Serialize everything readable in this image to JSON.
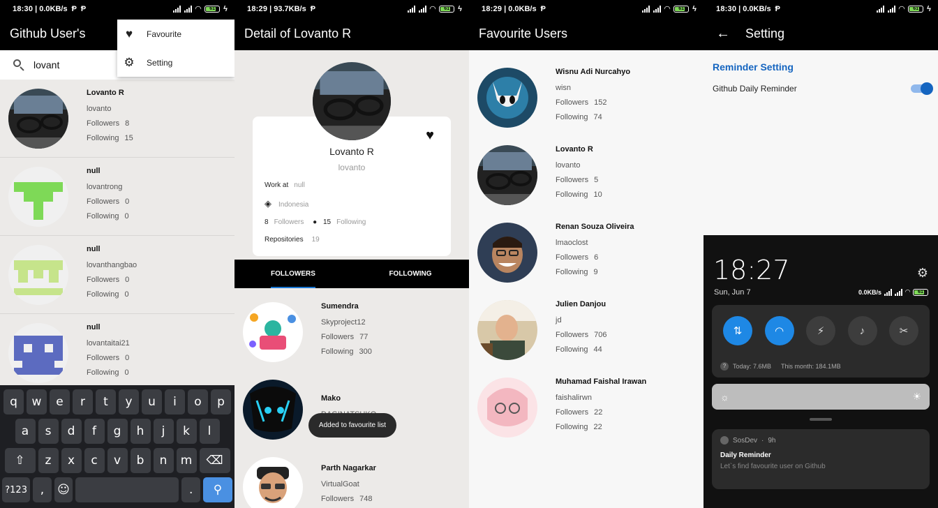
{
  "status": {
    "s1": {
      "time": "18:30",
      "speed": "0.0KB/s",
      "battery": "61"
    },
    "s2": {
      "time": "18:29",
      "speed": "93.7KB/s",
      "battery": "61"
    },
    "s3": {
      "time": "18:29",
      "speed": "0.0KB/s",
      "battery": "61"
    },
    "s4": {
      "time": "18:30",
      "speed": "0.0KB/s",
      "battery": "61"
    }
  },
  "search_screen": {
    "title": "Github User's",
    "search_value": "lovant",
    "menu": [
      {
        "label": "Favourite",
        "icon": "heart-icon"
      },
      {
        "label": "Setting",
        "icon": "gear-icon"
      }
    ],
    "users": [
      {
        "name": "Lovanto R",
        "login": "lovanto",
        "followers": "8",
        "following": "15",
        "avatar": "photo-glasses"
      },
      {
        "name": "null",
        "login": "lovantrong",
        "followers": "0",
        "following": "0",
        "avatar": "identicon-green"
      },
      {
        "name": "null",
        "login": "lovanthangbao",
        "followers": "0",
        "following": "0",
        "avatar": "identicon-lime"
      },
      {
        "name": "null",
        "login": "lovantaitai21",
        "followers": "0",
        "following": "0",
        "avatar": "identicon-purple"
      }
    ],
    "labels": {
      "followers": "Followers",
      "following": "Following"
    },
    "keyboard": {
      "row1": [
        "q",
        "w",
        "e",
        "r",
        "t",
        "y",
        "u",
        "i",
        "o",
        "p"
      ],
      "row2": [
        "a",
        "s",
        "d",
        "f",
        "g",
        "h",
        "j",
        "k",
        "l"
      ],
      "row3": [
        "z",
        "x",
        "c",
        "v",
        "b",
        "n",
        "m"
      ],
      "sym": "?123",
      "comma": ",",
      "period": "."
    }
  },
  "detail_screen": {
    "title": "Detail of Lovanto R",
    "name": "Lovanto R",
    "login": "lovanto",
    "work_label": "Work at",
    "work_value": "null",
    "location": "Indonesia",
    "followers_count": "8",
    "followers_label": "Followers",
    "following_count": "15",
    "following_label": "Following",
    "repos_label": "Repositories",
    "repos_value": "19",
    "tabs": [
      "FOLLOWERS",
      "FOLLOWING"
    ],
    "followers_list": [
      {
        "name": "Sumendra",
        "login": "Skyproject12",
        "followers": "77",
        "following": "300"
      },
      {
        "name": "Mako",
        "login": "DAGINATSUKO"
      },
      {
        "name": "Parth Nagarkar",
        "login": "VirtualGoat",
        "followers": "748"
      }
    ],
    "toast": "Added to favourite list"
  },
  "favourite_screen": {
    "title": "Favourite Users",
    "users": [
      {
        "name": "Wisnu Adi Nurcahyo",
        "login": "wisn",
        "followers": "152",
        "following": "74"
      },
      {
        "name": "Lovanto R",
        "login": "lovanto",
        "followers": "5",
        "following": "10"
      },
      {
        "name": "Renan Souza Oliveira",
        "login": "lmaoclost",
        "followers": "6",
        "following": "9"
      },
      {
        "name": "Julien Danjou",
        "login": "jd",
        "followers": "706",
        "following": "44"
      },
      {
        "name": "Muhamad Faishal Irawan",
        "login": "faishalirwn",
        "followers": "22",
        "following": "22"
      }
    ]
  },
  "setting_screen": {
    "title": "Setting",
    "section": "Reminder Setting",
    "option": "Github Daily Reminder",
    "toggle_on": true,
    "shade": {
      "clock": "18:27",
      "date": "Sun, Jun 7",
      "speed": "0.0KB/s",
      "battery": "61",
      "usage_today": "Today: 7.6MB",
      "usage_month": "This month: 184.1MB",
      "notification": {
        "app": "SosDev",
        "age": "9h",
        "title": "Daily Reminder",
        "text": "Let`s find favourite user on Github"
      }
    }
  }
}
